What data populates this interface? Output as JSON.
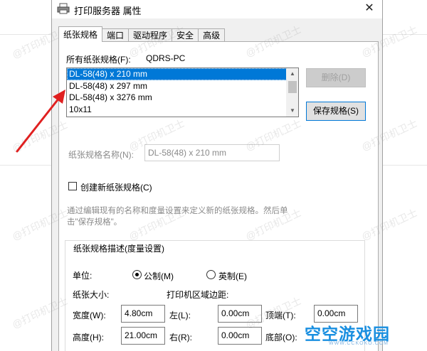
{
  "window": {
    "title": "打印服务器 属性",
    "close_glyph": "✕"
  },
  "tabs": [
    "纸张规格",
    "端口",
    "驱动程序",
    "安全",
    "高级"
  ],
  "forms": {
    "all_forms_label": "所有纸张规格(F):",
    "all_forms_mnemonic": "F",
    "server_name": "QDRS-PC",
    "items": [
      "DL-58(48) x 210 mm",
      "DL-58(48) x 297 mm",
      "DL-58(48) x 3276 mm",
      "10x11"
    ],
    "selected_index": 0
  },
  "buttons": {
    "delete_label": "删除(D)",
    "save_label": "保存规格(S)"
  },
  "form_name": {
    "label": "纸张规格名称(N):",
    "value": "DL-58(48) x 210 mm"
  },
  "create_new": {
    "label": "创建新纸张规格(C)",
    "checked": false
  },
  "hint_line1": "通过编辑现有的名称和度量设置来定义新的纸张规格。然后单",
  "hint_line2": "击\"保存规格\"。",
  "description": {
    "group_title": "纸张规格描述(度量设置)",
    "units_label": "单位:",
    "metric_label": "公制(M)",
    "english_label": "英制(E)",
    "metric_selected": true,
    "paper_size_label": "纸张大小:",
    "margins_label": "打印机区域边距:",
    "width_label": "宽度(W):",
    "width_value": "4.80cm",
    "height_label": "高度(H):",
    "height_value": "21.00cm",
    "left_label": "左(L):",
    "left_value": "0.00cm",
    "right_label": "右(R):",
    "right_value": "0.00cm",
    "top_label": "顶端(T):",
    "top_value": "0.00cm",
    "bottom_label": "底部(O):"
  },
  "watermark": "@打印机卫士",
  "logo": {
    "text": "空空游戏园",
    "url": "WWW.CCKOKO.COM"
  },
  "colors": {
    "selection": "#0078d7",
    "arrow": "#e02020",
    "dialog_bg": "#f0f0f0",
    "panel_bg": "#ffffff"
  }
}
